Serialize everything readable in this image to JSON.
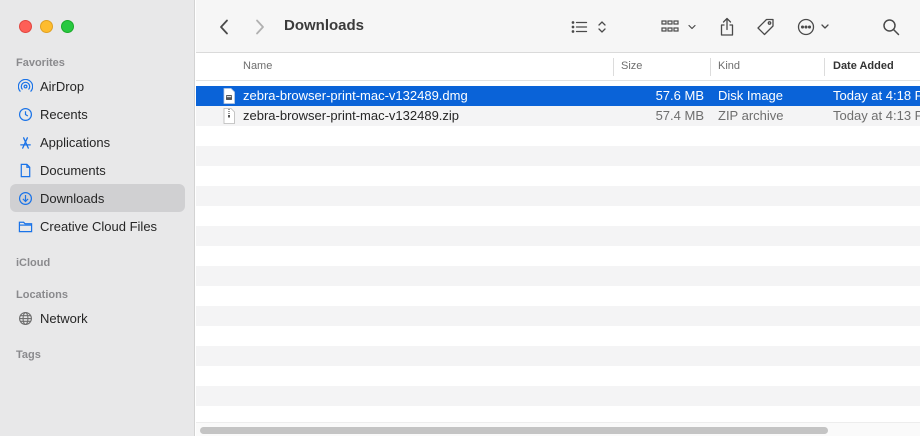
{
  "window": {
    "title": "Downloads"
  },
  "sidebar": {
    "sections": {
      "favorites": "Favorites",
      "icloud": "iCloud",
      "locations": "Locations",
      "tags": "Tags"
    },
    "favorites": [
      {
        "label": "AirDrop",
        "icon": "airdrop-icon"
      },
      {
        "label": "Recents",
        "icon": "clock-icon"
      },
      {
        "label": "Applications",
        "icon": "applications-icon"
      },
      {
        "label": "Documents",
        "icon": "document-icon"
      },
      {
        "label": "Downloads",
        "icon": "download-icon",
        "selected": true
      },
      {
        "label": "Creative Cloud Files",
        "icon": "folder-icon"
      }
    ],
    "locations": [
      {
        "label": "Network",
        "icon": "globe-icon"
      }
    ]
  },
  "columns": {
    "name": "Name",
    "size": "Size",
    "kind": "Kind",
    "date_added": "Date Added"
  },
  "files": [
    {
      "name": "zebra-browser-print-mac-v132489.dmg",
      "size": "57.6 MB",
      "kind": "Disk Image",
      "date": "Today at 4:18 P",
      "selected": true,
      "icon": "disk-image-icon"
    },
    {
      "name": "zebra-browser-print-mac-v132489.zip",
      "size": "57.4 MB",
      "kind": "ZIP archive",
      "date": "Today at 4:13 P",
      "selected": false,
      "icon": "zip-file-icon"
    }
  ],
  "colors": {
    "selection": "#0a63d8",
    "sidebar_bg": "#e8e8e9",
    "accent_icon": "#1a73e8"
  }
}
